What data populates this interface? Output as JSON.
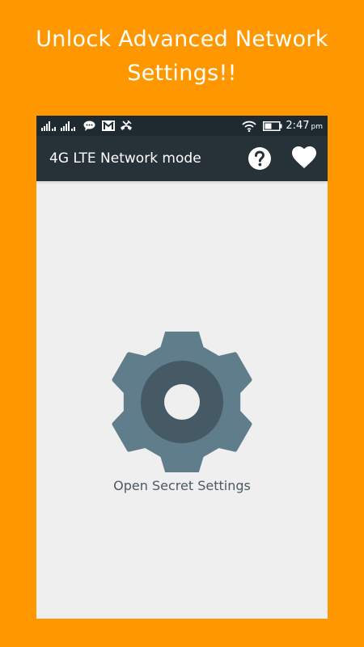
{
  "promo": {
    "title": "Unlock Advanced Network Settings!!"
  },
  "status_bar": {
    "time": "2:47",
    "ampm": "pm",
    "icons": [
      "signal-icon",
      "signal-icon",
      "chat-icon",
      "gmail-icon",
      "missed-call-icon",
      "wifi-icon",
      "battery-icon"
    ]
  },
  "toolbar": {
    "title": "4G LTE Network mode",
    "icons": [
      "help-icon",
      "heart-icon"
    ]
  },
  "main": {
    "settings_label": "Open Secret Settings",
    "icon": "gear-icon"
  },
  "colors": {
    "background": "#FF9800",
    "toolbar": "#263238",
    "status_bar": "#1E2A2F",
    "content": "#EFEFEF",
    "gear": "#607D8B",
    "gear_inner": "#455A64"
  }
}
